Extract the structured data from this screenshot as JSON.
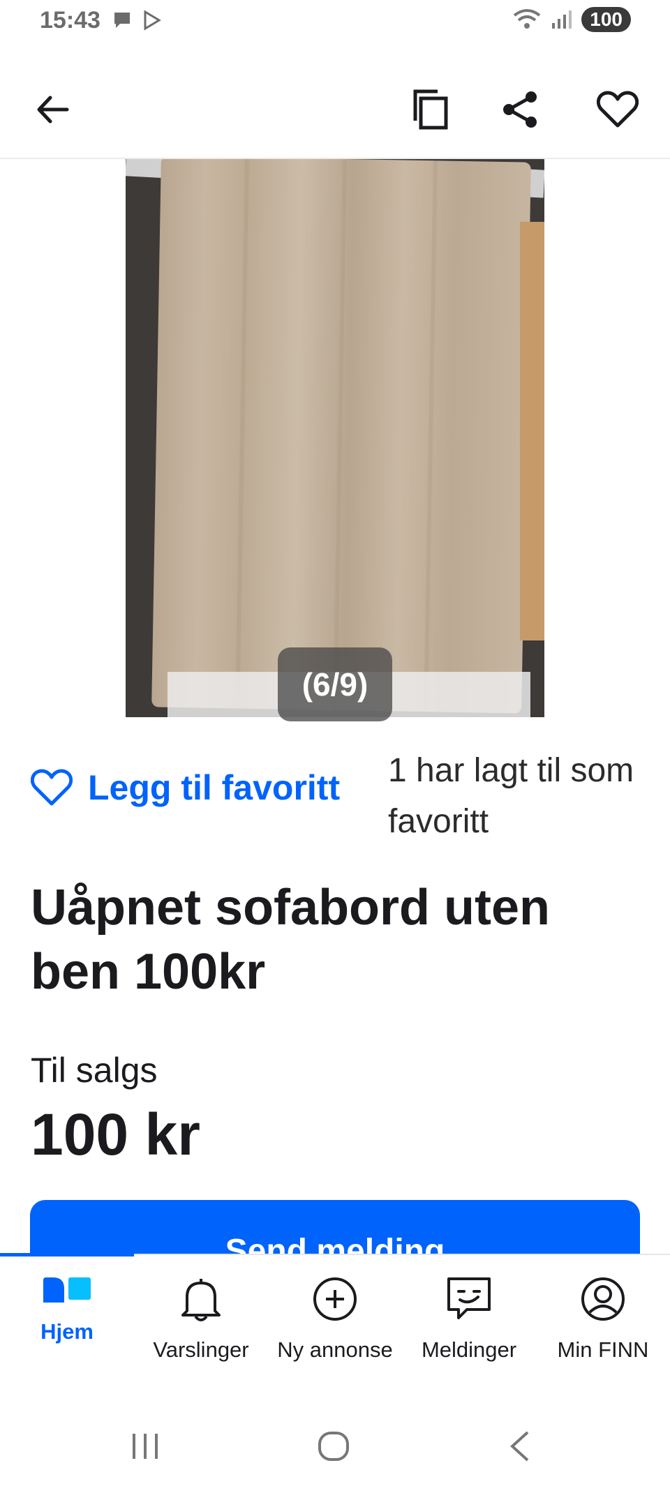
{
  "status_bar": {
    "time": "15:43",
    "battery": "100",
    "icons_left": [
      "chat-bubble-icon",
      "play-store-icon"
    ],
    "icons_right": [
      "wifi-icon",
      "signal-icon",
      "battery-icon"
    ]
  },
  "top_bar": {
    "back": "arrow-left-icon",
    "actions": [
      "copy-icon",
      "share-icon",
      "heart-icon"
    ]
  },
  "gallery": {
    "counter": "(6/9)"
  },
  "favorite": {
    "label": "Legg til favoritt",
    "count_text": "1 har lagt til som favoritt"
  },
  "listing": {
    "title": "Uåpnet sofabord uten ben 100kr",
    "type_label": "Til salgs",
    "price": "100 kr"
  },
  "cta": {
    "send_label": "Send melding"
  },
  "bottom_nav": {
    "items": [
      {
        "label": "Hjem",
        "icon": "home-icon",
        "active": true
      },
      {
        "label": "Varslinger",
        "icon": "bell-icon",
        "active": false
      },
      {
        "label": "Ny annonse",
        "icon": "plus-circle-icon",
        "active": false
      },
      {
        "label": "Meldinger",
        "icon": "chat-icon",
        "active": false
      },
      {
        "label": "Min FINN",
        "icon": "profile-icon",
        "active": false
      }
    ]
  },
  "colors": {
    "accent": "#0063fb",
    "text": "#1b1b1f"
  }
}
